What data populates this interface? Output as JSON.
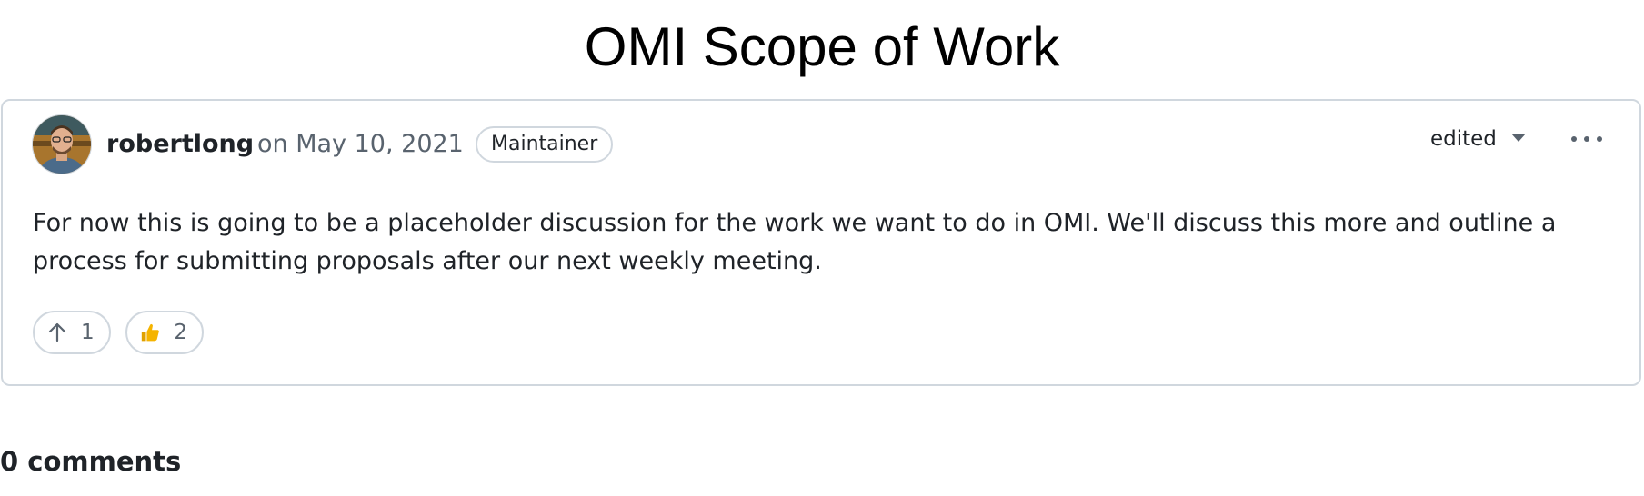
{
  "page": {
    "title": "OMI Scope of Work"
  },
  "post": {
    "author": "robertlong",
    "date": "on May 10, 2021",
    "role_badge": "Maintainer",
    "edited_label": "edited",
    "body": "For now this is going to be a placeholder discussion for the work we want to do in OMI. We'll discuss this more and outline a process for submitting proposals after our next weekly meeting.",
    "reactions": [
      {
        "icon": "arrow-up-icon",
        "count": "1"
      },
      {
        "icon": "thumbs-up-icon",
        "count": "2"
      }
    ]
  },
  "comments": {
    "count_label": "0 comments"
  },
  "colors": {
    "border": "#d0d7de",
    "text": "#1f2328",
    "muted": "#59636e",
    "thumbs": "#f5b400"
  }
}
